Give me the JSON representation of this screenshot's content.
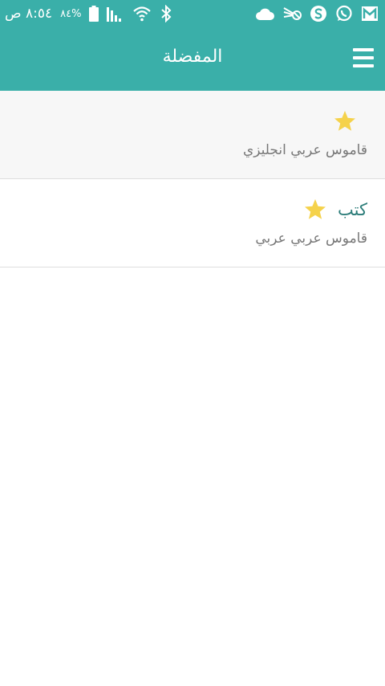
{
  "status_bar": {
    "time": "٨:٥٤ ص",
    "battery_percent": "٨٤%"
  },
  "app_bar": {
    "title": "المفضلة"
  },
  "favorites": [
    {
      "title": "",
      "subtitle": "قاموس عربي انجليزي",
      "starred": true
    },
    {
      "title": "كتب",
      "subtitle": "قاموس عربي عربي",
      "starred": true
    }
  ],
  "colors": {
    "header": "#3aafa9",
    "star": "#f5d24b",
    "title_text": "#2d7d7a"
  }
}
